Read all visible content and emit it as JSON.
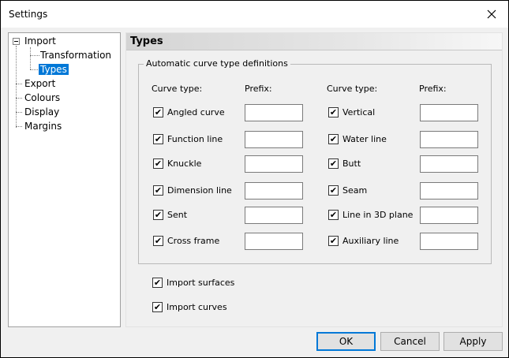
{
  "window": {
    "title": "Settings"
  },
  "tree": {
    "items": [
      {
        "label": "Import"
      },
      {
        "label": "Transformation"
      },
      {
        "label": "Types"
      },
      {
        "label": "Export"
      },
      {
        "label": "Colours"
      },
      {
        "label": "Display"
      },
      {
        "label": "Margins"
      }
    ]
  },
  "panel": {
    "title": "Types",
    "group_label": "Automatic curve type definitions",
    "col_curve_type": "Curve type:",
    "col_prefix": "Prefix:",
    "left_rows": [
      {
        "label": "Angled curve",
        "checked": true,
        "prefix": ""
      },
      {
        "label": "Function line",
        "checked": true,
        "prefix": ""
      },
      {
        "label": "Knuckle",
        "checked": true,
        "prefix": ""
      },
      {
        "label": "Dimension line",
        "checked": true,
        "prefix": ""
      },
      {
        "label": "Sent",
        "checked": true,
        "prefix": ""
      },
      {
        "label": "Cross frame",
        "checked": true,
        "prefix": ""
      }
    ],
    "right_rows": [
      {
        "label": "Vertical",
        "checked": true,
        "prefix": ""
      },
      {
        "label": "Water line",
        "checked": true,
        "prefix": ""
      },
      {
        "label": "Butt",
        "checked": true,
        "prefix": ""
      },
      {
        "label": "Seam",
        "checked": true,
        "prefix": ""
      },
      {
        "label": "Line in 3D plane",
        "checked": true,
        "prefix": ""
      },
      {
        "label": "Auxiliary line",
        "checked": true,
        "prefix": ""
      }
    ],
    "import_surfaces": {
      "label": "Import surfaces",
      "checked": true
    },
    "import_curves": {
      "label": "Import curves",
      "checked": true
    }
  },
  "buttons": {
    "ok": "OK",
    "cancel": "Cancel",
    "apply": "Apply"
  },
  "colors": {
    "selection": "#0078d7",
    "dialog_bg": "#f0f0f0"
  }
}
